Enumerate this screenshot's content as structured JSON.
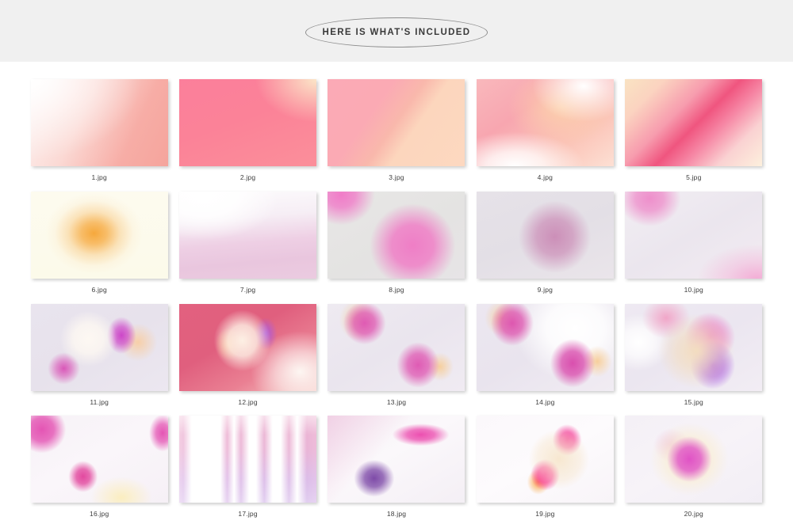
{
  "header": {
    "badge_title": "HERE IS WHAT'S INCLUDED"
  },
  "gallery": {
    "items": [
      {
        "id": 1,
        "caption": "1.jpg",
        "art": "g1",
        "description": "white to salmon pink diagonal gradient"
      },
      {
        "id": 2,
        "caption": "2.jpg",
        "art": "g2",
        "description": "vivid pink with cream top-right corner"
      },
      {
        "id": 3,
        "caption": "3.jpg",
        "art": "g3",
        "description": "pink to peach diagonal split"
      },
      {
        "id": 4,
        "caption": "4.jpg",
        "art": "g4",
        "description": "soft pink peach with white swoosh"
      },
      {
        "id": 5,
        "caption": "5.jpg",
        "art": "g5",
        "description": "cream and magenta diagonal band"
      },
      {
        "id": 6,
        "caption": "6.jpg",
        "art": "g6",
        "description": "orange radial glow on cream"
      },
      {
        "id": 7,
        "caption": "7.jpg",
        "art": "g7",
        "description": "white fading to lilac pink"
      },
      {
        "id": 8,
        "caption": "8.jpg",
        "art": "g8",
        "description": "bright pink blobs on grey"
      },
      {
        "id": 9,
        "caption": "9.jpg",
        "art": "g9",
        "description": "muted mauve circle on grey lilac"
      },
      {
        "id": 10,
        "caption": "10.jpg",
        "art": "g10",
        "description": "pink blob top-left with pink tint"
      },
      {
        "id": 11,
        "caption": "11.jpg",
        "art": "g11",
        "description": "lavender with magenta and cream blobs"
      },
      {
        "id": 12,
        "caption": "12.jpg",
        "art": "g12",
        "description": "deep rose with cream centre and purple accent"
      },
      {
        "id": 13,
        "caption": "13.jpg",
        "art": "g13",
        "description": "two magenta blobs on lavender"
      },
      {
        "id": 14,
        "caption": "14.jpg",
        "art": "g14",
        "description": "magenta blobs with white diagonal sweep"
      },
      {
        "id": 15,
        "caption": "15.jpg",
        "art": "g15",
        "description": "iridescent sphere pink cream violet"
      },
      {
        "id": 16,
        "caption": "16.jpg",
        "art": "g16",
        "description": "scattered magenta blobs on white"
      },
      {
        "id": 17,
        "caption": "17.jpg",
        "art": "g17",
        "description": "vertical stripes rose to violet"
      },
      {
        "id": 18,
        "caption": "18.jpg",
        "art": "g18",
        "description": "diagonal magenta and purple streak"
      },
      {
        "id": 19,
        "caption": "19.jpg",
        "art": "g19",
        "description": "circular form with pink wedges"
      },
      {
        "id": 20,
        "caption": "20.jpg",
        "art": "g20",
        "description": "central magenta bloom with cream halo"
      }
    ]
  },
  "colors": {
    "header_band": "#f0f0f0",
    "page_background": "#ffffff",
    "badge_border": "#8d8d8d",
    "title_text": "#3a3a3a",
    "caption_text": "#3d3d3d"
  }
}
